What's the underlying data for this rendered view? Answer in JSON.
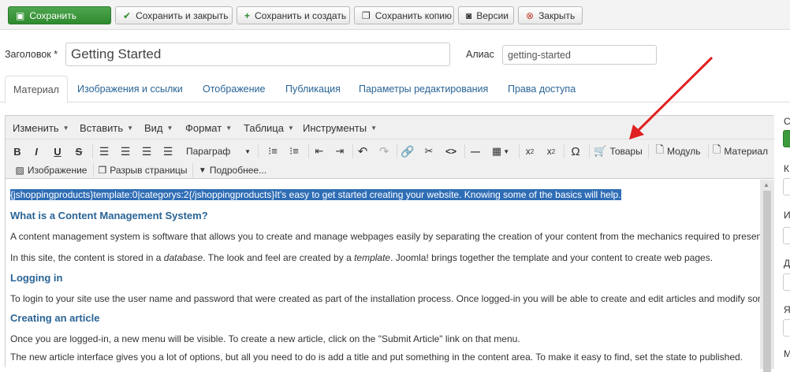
{
  "toolbar": {
    "save": "Сохранить",
    "save_close": "Сохранить и закрыть",
    "save_new": "Сохранить и создать",
    "save_copy": "Сохранить копию",
    "versions": "Версии",
    "close": "Закрыть"
  },
  "form": {
    "title_label": "Заголовок *",
    "title_value": "Getting Started",
    "alias_label": "Алиас",
    "alias_value": "getting-started"
  },
  "tabs": [
    "Материал",
    "Изображения и ссылки",
    "Отображение",
    "Публикация",
    "Параметры редактирования",
    "Права доступа"
  ],
  "editor_menu": [
    "Изменить",
    "Вставить",
    "Вид",
    "Формат",
    "Таблица",
    "Инструменты"
  ],
  "editor_toolbar": {
    "format_select": "Параграф",
    "goods_button": "Товары",
    "module_button": "Модуль",
    "article_button": "Материал",
    "image_button": "Изображение",
    "pagebreak_button": "Разрыв страницы",
    "readmore_button": "Подробнее..."
  },
  "content": {
    "selected_line": "{jshoppingproducts}template:0|categorys:2{/jshoppingproducts}It's easy to get started creating your website. Knowing some of the basics will help.",
    "h_cms": "What is a Content Management System?",
    "p_cms": "A content management system is software that allows you to create and manage webpages easily by separating the creation of your content from the mechanics required to present it on the web.",
    "p_site_1": "In this site, the content is stored in a ",
    "p_site_db": "database",
    "p_site_2": ". The look and feel are created by a ",
    "p_site_tpl": "template",
    "p_site_3": ". Joomla! brings together the template and your content to create web pages.",
    "h_login": "Logging in",
    "p_login": "To login to your site use the user name and password that were created as part of the installation process. Once logged-in you will be able to create and edit articles and modify some settings.",
    "h_article": "Creating an article",
    "p_article": "Once you are logged-in, a new menu will be visible. To create a new article, click on the \"Submit Article\" link on that menu.",
    "p_new": "The new article interface gives you a lot of options, but all you need to do is add a title and put something in the content area. To make it easy to find, set the state to published."
  },
  "right_col": [
    "С",
    "К",
    "И",
    "Д",
    "Я",
    "М"
  ],
  "colors": {
    "primary": "#2f8a2f",
    "link": "#2a6496",
    "selection": "#2f6db5",
    "arrow": "#e02020"
  }
}
